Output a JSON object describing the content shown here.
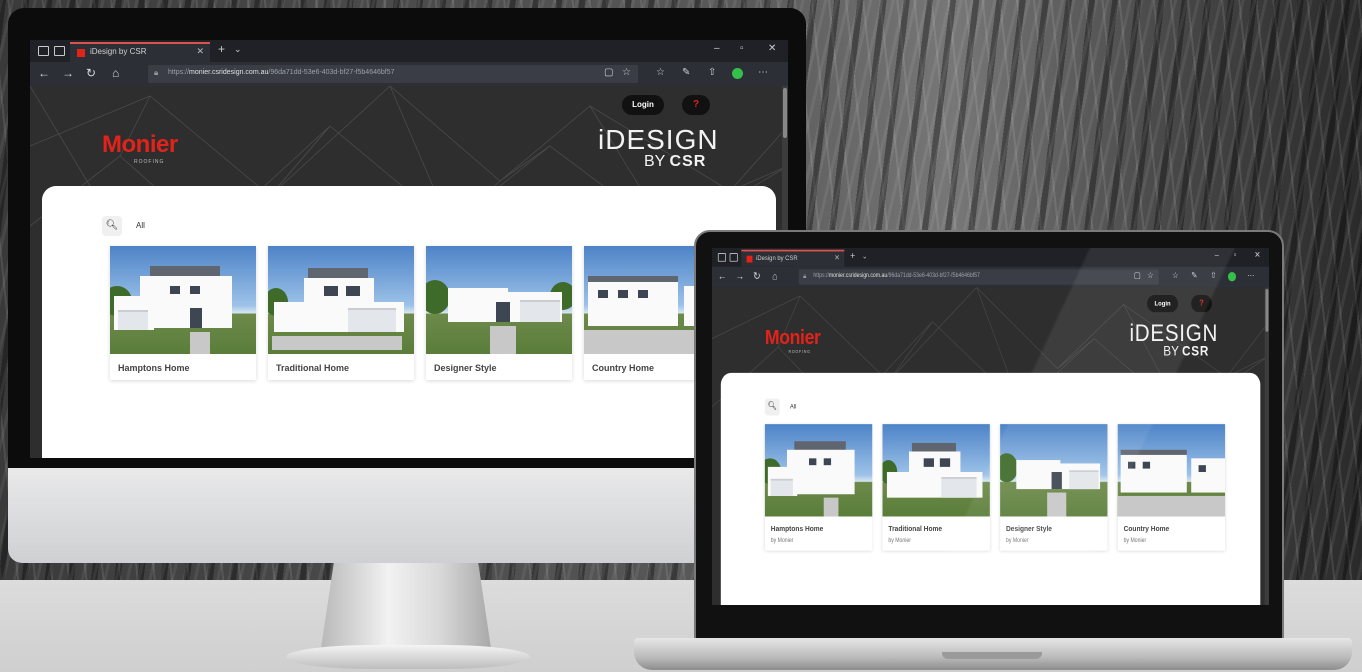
{
  "browser": {
    "tab_title": "iDesign by CSR",
    "url_domain": "monier.csridesign.com.au",
    "url_path": "/96da71dd-53e6-403d-bf27-f5b4646bf57",
    "login_label": "Login",
    "help_label": "?"
  },
  "brand": {
    "monier": "Monier",
    "roofing": "ROOFING",
    "idesign": "iDESIGN",
    "by": "BY",
    "csr": "CSR"
  },
  "filter": {
    "all": "All"
  },
  "cards": [
    {
      "title": "Hamptons Home",
      "subtitle": "by Monier"
    },
    {
      "title": "Traditional Home",
      "subtitle": "by Monier"
    },
    {
      "title": "Designer Style",
      "subtitle": "by Monier"
    },
    {
      "title": "Country Home",
      "subtitle": "by Monier"
    }
  ],
  "colors": {
    "brand_red": "#e2231a",
    "header_dark": "#2e2e2e",
    "browser_chrome": "#1f2126"
  }
}
